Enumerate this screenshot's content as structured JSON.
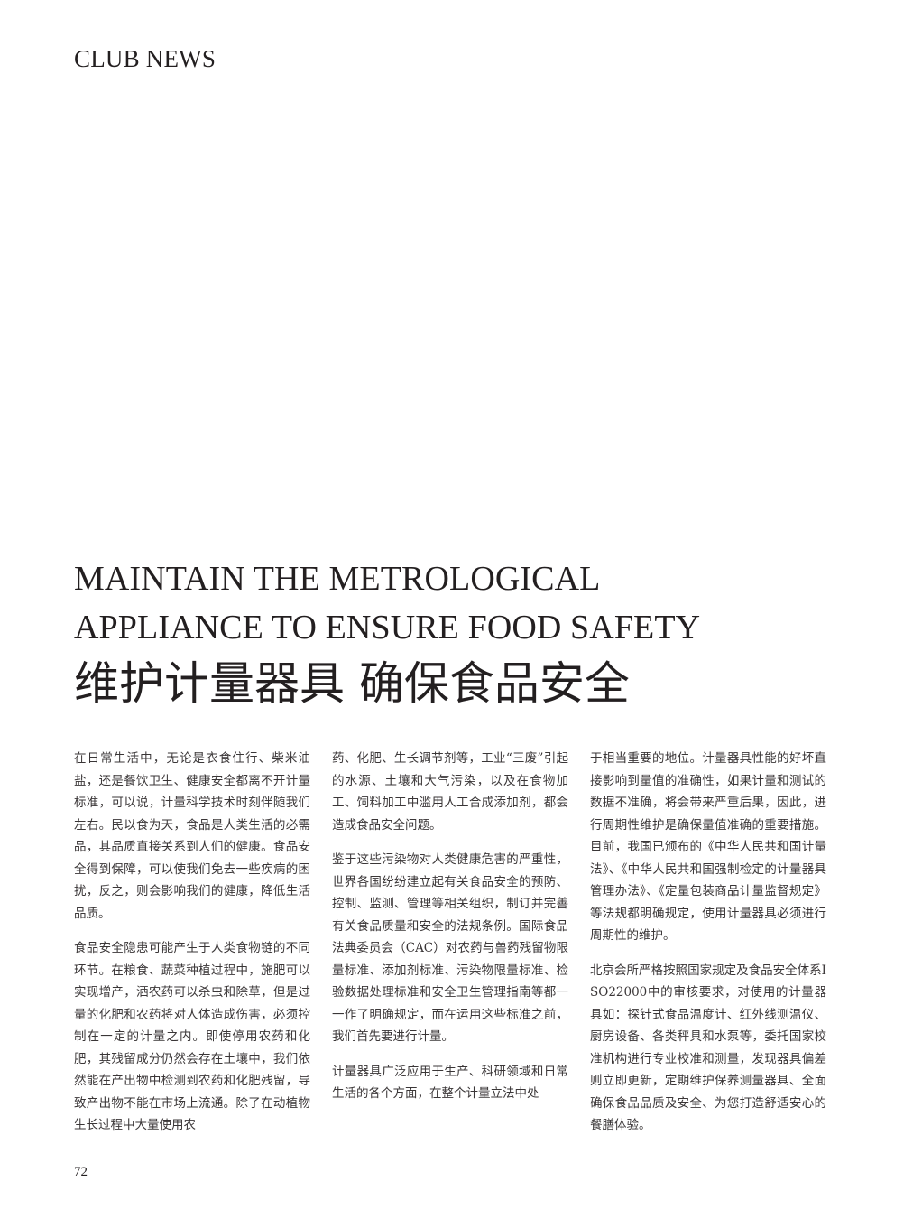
{
  "section_label": "CLUB NEWS",
  "headline": {
    "en_line1": "MAINTAIN THE METROLOGICAL",
    "en_line2": "APPLIANCE TO ENSURE FOOD SAFETY",
    "zh": "维护计量器具 确保食品安全"
  },
  "columns": [
    {
      "paragraphs": [
        "在日常生活中，无论是衣食住行、柴米油盐，还是餐饮卫生、健康安全都离不开计量标准，可以说，计量科学技术时刻伴随我们左右。民以食为天，食品是人类生活的必需品，其品质直接关系到人们的健康。食品安全得到保障，可以使我们免去一些疾病的困扰，反之，则会影响我们的健康，降低生活品质。",
        "食品安全隐患可能产生于人类食物链的不同环节。在粮食、蔬菜种植过程中，施肥可以实现增产，洒农药可以杀虫和除草，但是过量的化肥和农药将对人体造成伤害，必须控制在一定的计量之内。即使停用农药和化肥，其残留成分仍然会存在土壤中，我们依然能在产出物中检测到农药和化肥残留，导致产出物不能在市场上流通。除了在动植物生长过程中大量使用农"
      ]
    },
    {
      "paragraphs": [
        "药、化肥、生长调节剂等，工业“三废”引起的水源、土壤和大气污染，以及在食物加工、饲料加工中滥用人工合成添加剂，都会造成食品安全问题。",
        "鉴于这些污染物对人类健康危害的严重性，世界各国纷纷建立起有关食品安全的预防、控制、监测、管理等相关组织，制订并完善有关食品质量和安全的法规条例。国际食品法典委员会（CAC）对农药与兽药残留物限量标准、添加剂标准、污染物限量标准、检验数据处理标准和安全卫生管理指南等都一一作了明确规定，而在运用这些标准之前，我们首先要进行计量。",
        "计量器具广泛应用于生产、科研领域和日常生活的各个方面，在整个计量立法中处"
      ]
    },
    {
      "paragraphs": [
        "于相当重要的地位。计量器具性能的好坏直接影响到量值的准确性，如果计量和测试的数据不准确，将会带来严重后果，因此，进行周期性维护是确保量值准确的重要措施。目前，我国已颁布的《中华人民共和国计量法》、《中华人民共和国强制检定的计量器具管理办法》、《定量包装商品计量监督规定》等法规都明确规定，使用计量器具必须进行周期性的维护。",
        "北京会所严格按照国家规定及食品安全体系ISO22000中的审核要求，对使用的计量器具如：探针式食品温度计、红外线测温仪、厨房设备、各类秤具和水泵等，委托国家校准机构进行专业校准和测量，发现器具偏差则立即更新，定期维护保养测量器具、全面确保食品品质及安全、为您打造舒适安心的餐膳体验。"
      ]
    }
  ],
  "page_number": "72"
}
